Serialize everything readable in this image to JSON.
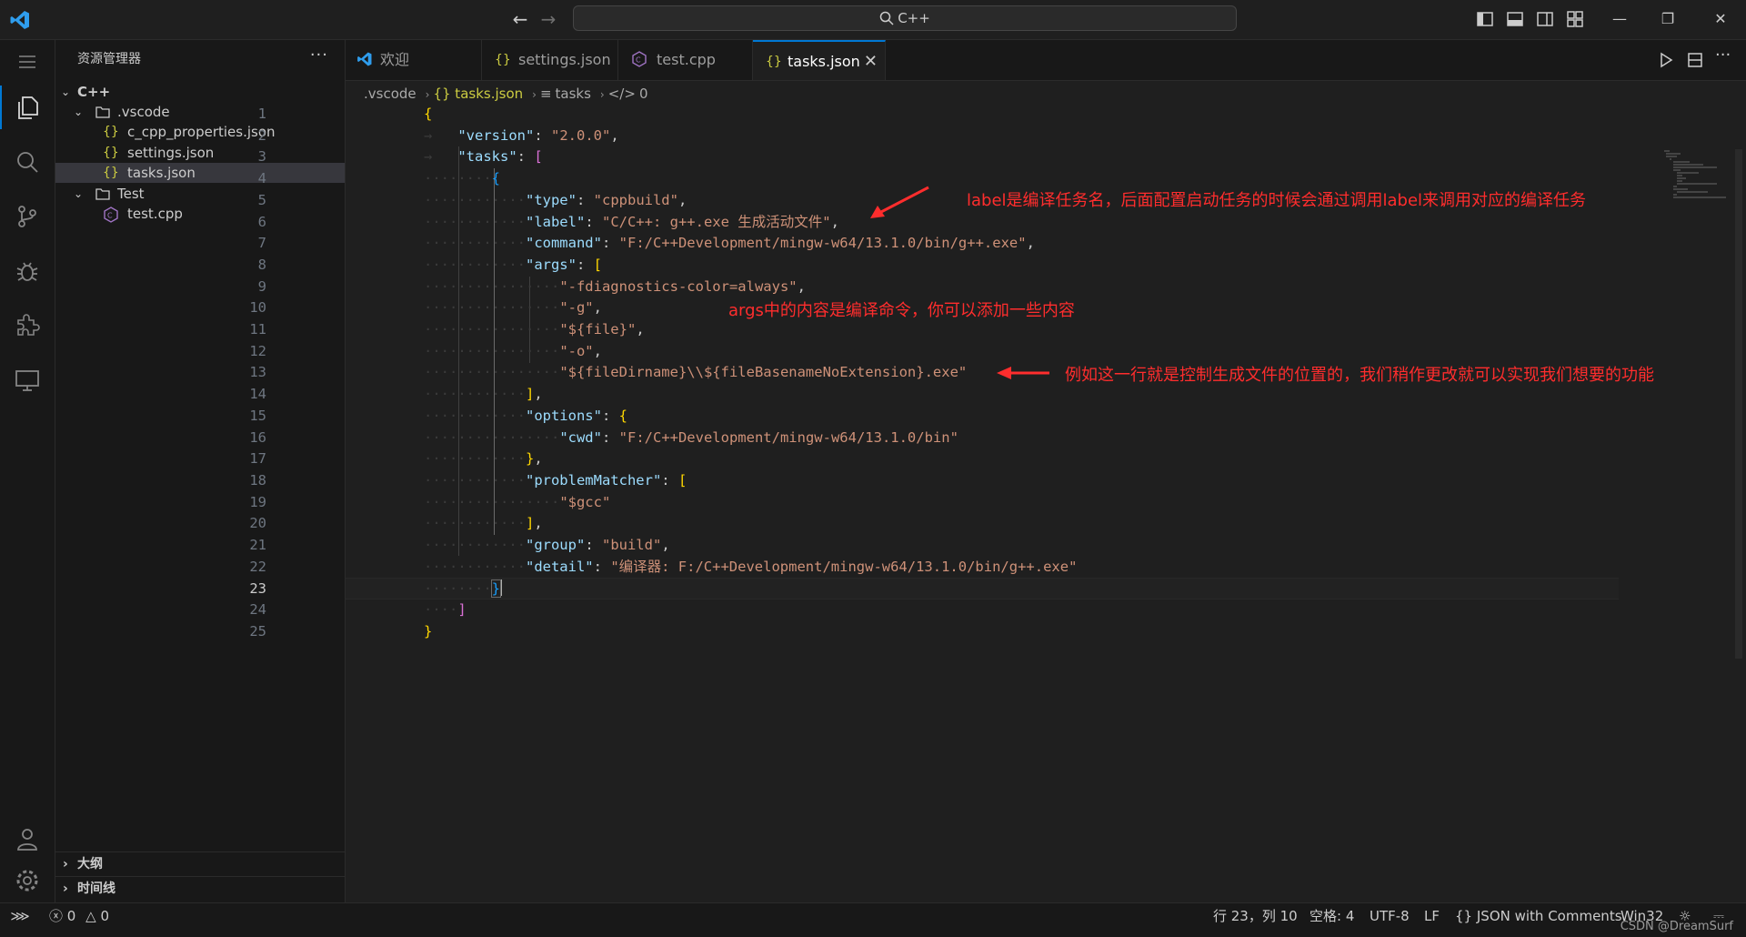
{
  "titlebar": {
    "search_text": "C++",
    "back_icon": "arrow-left-icon",
    "forward_icon": "arrow-right-icon",
    "layout_icons": [
      "toggle-primary-sidebar-icon",
      "toggle-panel-icon",
      "toggle-secondary-sidebar-icon",
      "customize-layout-icon"
    ],
    "window_controls": {
      "minimize": "—",
      "restore": "❐",
      "close": "✕"
    }
  },
  "activity_bar": {
    "items": [
      "explorer-icon",
      "search-icon",
      "source-control-icon",
      "run-debug-icon",
      "extensions-icon",
      "remote-explorer-icon"
    ],
    "bottom": [
      "accounts-icon",
      "manage-gear-icon"
    ]
  },
  "sidebar": {
    "title": "资源管理器",
    "more": "···",
    "tree": [
      {
        "label": "C++",
        "type": "root"
      },
      {
        "label": ".vscode",
        "type": "folder"
      },
      {
        "label": "c_cpp_properties.json",
        "type": "json"
      },
      {
        "label": "settings.json",
        "type": "json"
      },
      {
        "label": "tasks.json",
        "type": "json",
        "selected": true
      },
      {
        "label": "Test",
        "type": "folder"
      },
      {
        "label": "test.cpp",
        "type": "cpp"
      }
    ],
    "sections": [
      "大纲",
      "时间线"
    ]
  },
  "tabs": [
    {
      "label": "欢迎",
      "icon": "vscode-logo-icon"
    },
    {
      "label": "settings.json",
      "icon": "json-braces-icon"
    },
    {
      "label": "test.cpp",
      "icon": "cpp-file-icon"
    },
    {
      "label": "tasks.json",
      "icon": "json-braces-icon",
      "active": true,
      "close": "✕"
    }
  ],
  "breadcrumb": {
    "items": [
      ".vscode",
      "{} tasks.json",
      "tasks",
      "0"
    ]
  },
  "editor": {
    "current_line": "23",
    "line_numbers": [
      "1",
      "2",
      "3",
      "4",
      "5",
      "6",
      "7",
      "8",
      "9",
      "10",
      "11",
      "12",
      "13",
      "14",
      "15",
      "16",
      "17",
      "18",
      "19",
      "20",
      "21",
      "22",
      "23",
      "24",
      "25"
    ],
    "keys": {
      "version": "\"version\"",
      "tasks": "\"tasks\"",
      "type": "\"type\"",
      "label": "\"label\"",
      "command": "\"command\"",
      "args": "\"args\"",
      "options": "\"options\"",
      "cwd": "\"cwd\"",
      "problemMatcher": "\"problemMatcher\"",
      "group": "\"group\"",
      "detail": "\"detail\""
    },
    "values": {
      "version": "\"2.0.0\"",
      "type": "\"cppbuild\"",
      "label": "\"C/C++: g++.exe 生成活动文件\"",
      "command": "\"F:/C++Development/mingw-w64/13.1.0/bin/g++.exe\"",
      "arg1": "\"-fdiagnostics-color=always\"",
      "arg2": "\"-g\"",
      "arg3": "\"${file}\"",
      "arg4": "\"-o\"",
      "arg5": "\"${fileDirname}\\\\${fileBasenameNoExtension}.exe\"",
      "cwd": "\"F:/C++Development/mingw-w64/13.1.0/bin\"",
      "pm1": "\"$gcc\"",
      "group": "\"build\"",
      "detail": "\"编译器: F:/C++Development/mingw-w64/13.1.0/bin/g++.exe\""
    }
  },
  "annotations": {
    "label_note": "label是编译任务名，后面配置启动任务的时候会通过调用label来调用对应的编译任务",
    "args_note": "args中的内容是编译命令，你可以添加一些内容",
    "output_note": "例如这一行就是控制生成文件的位置的，我们稍作更改就可以实现我们想要的功能",
    "color": "#ff2d2d"
  },
  "statusbar": {
    "remote_icon": "remote-icon",
    "errors": "0",
    "warnings": "0",
    "position": "行 23，列 10",
    "spaces": "空格: 4",
    "encoding": "UTF-8",
    "eol": "LF",
    "language": "JSON with Comments",
    "platform": "Win32",
    "watermark": "CSDN @DreamSurf"
  },
  "colors": {
    "accent": "#0078d4",
    "key": "#9cdcfe",
    "string": "#ce9178",
    "bracket_level1": "#ffd700",
    "bracket_level2": "#da70d6",
    "bracket_level3": "#179fff"
  }
}
